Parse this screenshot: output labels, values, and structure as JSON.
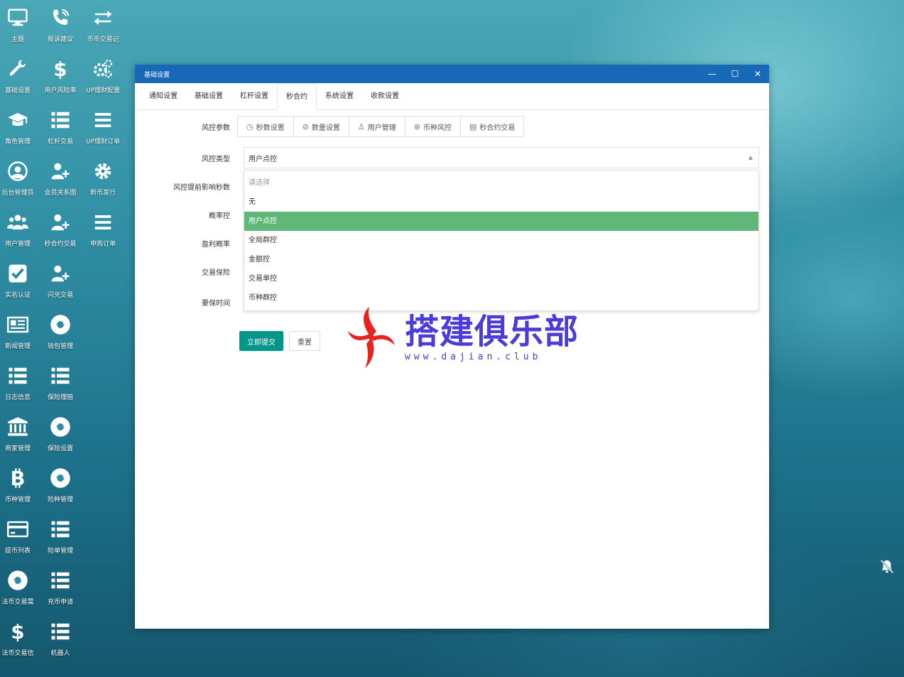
{
  "desktop": {
    "icons": [
      {
        "label": "主题",
        "icon": "monitor-icon"
      },
      {
        "label": "投诉建议",
        "icon": "phone-icon"
      },
      {
        "label": "币币交易记",
        "icon": "exchange-arrows-icon"
      },
      {
        "label": "基础设置",
        "icon": "wrench-icon"
      },
      {
        "label": "用户风险率",
        "icon": "dollar-icon"
      },
      {
        "label": "UP理财配置",
        "icon": "gears-icon"
      },
      {
        "label": "角色管理",
        "icon": "graduation-cap-icon"
      },
      {
        "label": "杠杆交易",
        "icon": "list-icon"
      },
      {
        "label": "UP理财订单",
        "icon": "bars-icon"
      },
      {
        "label": "后台管理员",
        "icon": "user-circle-icon"
      },
      {
        "label": "会员关系图",
        "icon": "user-plus-icon"
      },
      {
        "label": "新币发行",
        "icon": "gear-icon"
      },
      {
        "label": "用户管理",
        "icon": "users-icon"
      },
      {
        "label": "秒合约交易",
        "icon": "user-plus-icon"
      },
      {
        "label": "申购订单",
        "icon": "bars-icon"
      },
      {
        "label": "实名认证",
        "icon": "checkbox-icon"
      },
      {
        "label": "闪兑交易",
        "icon": "user-plus-icon"
      },
      {
        "label": "新闻管理",
        "icon": "newspaper-icon"
      },
      {
        "label": "钱包管理",
        "icon": "link-circle-icon"
      },
      {
        "label": "日志信息",
        "icon": "list-icon"
      },
      {
        "label": "保险理赔",
        "icon": "list-icon"
      },
      {
        "label": "商家管理",
        "icon": "bank-icon"
      },
      {
        "label": "保险设置",
        "icon": "link-circle-icon"
      },
      {
        "label": "币种管理",
        "icon": "bitcoin-icon"
      },
      {
        "label": "险种管理",
        "icon": "link-circle-icon"
      },
      {
        "label": "提币列表",
        "icon": "credit-card-icon"
      },
      {
        "label": "险单管理",
        "icon": "list-icon"
      },
      {
        "label": "法币交易需",
        "icon": "link-circle-icon"
      },
      {
        "label": "充币申请",
        "icon": "list-icon"
      },
      {
        "label": "法币交易信",
        "icon": "dollar-icon"
      },
      {
        "label": "机器人",
        "icon": "list-icon"
      }
    ]
  },
  "window": {
    "title": "基础设置",
    "controls": {
      "minimize": "—",
      "maximize": "☐",
      "close": "✕"
    },
    "tabs": [
      "通知设置",
      "基础设置",
      "杠杆设置",
      "秒合约",
      "系统设置",
      "收款设置"
    ],
    "active_tab": "秒合约"
  },
  "form": {
    "risk_params_label": "风控参数",
    "risk_params_buttons": [
      {
        "icon": "clock-icon",
        "label": "秒数设置"
      },
      {
        "icon": "compass-icon",
        "label": "数量设置"
      },
      {
        "icon": "user-icon",
        "label": "用户管理"
      },
      {
        "icon": "coin-icon",
        "label": "币种风控"
      },
      {
        "icon": "clipboard-icon",
        "label": "秒合约交易"
      }
    ],
    "risk_type_label": "风控类型",
    "risk_type_value": "用户点控",
    "risk_type_options": [
      "请选择",
      "无",
      "用户点控",
      "全局群控",
      "金额控",
      "交易单控",
      "币种群控"
    ],
    "labels": {
      "advance_seconds": "风控提前影响秒数",
      "probability": "概率控",
      "profit_rate": "盈利概率",
      "insurance": "交易保险",
      "protect_time": "要保时间"
    },
    "submit_label": "立即提交",
    "reset_label": "重置"
  },
  "watermark": {
    "text": "搭建俱乐部",
    "url": "www.dajian.club"
  },
  "colors": {
    "titlebar": "#1769b8",
    "selected_option": "#5fb878",
    "primary_button": "#009688",
    "watermark_text": "#4b3bd8",
    "watermark_logo": "#e8231f"
  }
}
